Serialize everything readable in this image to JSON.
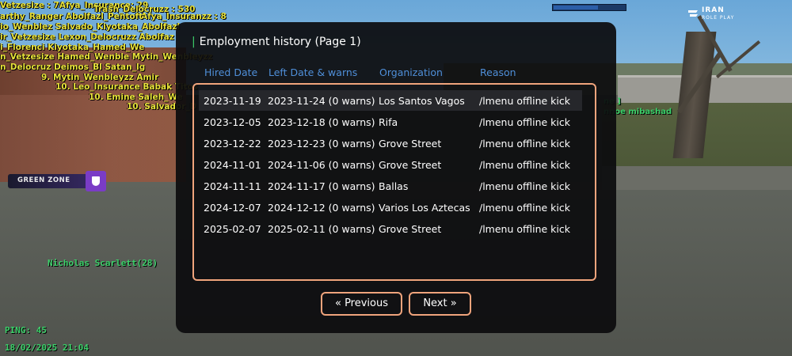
{
  "dialog": {
    "title": "Employment history (Page 1)",
    "columns": [
      "Hired Date",
      "Left Date & warns",
      "Organization",
      "Reason"
    ],
    "rows": [
      [
        "2023-11-19",
        "2023-11-24 (0 warns)",
        "Los Santos Vagos",
        "/lmenu offline kick"
      ],
      [
        "2023-12-05",
        "2023-12-18 (0 warns)",
        "Rifa",
        "/lmenu offline kick"
      ],
      [
        "2023-12-22",
        "2023-12-23 (0 warns)",
        "Grove Street",
        "/lmenu offline kick"
      ],
      [
        "2024-11-01",
        "2024-11-06 (0 warns)",
        "Grove Street",
        "/lmenu offline kick"
      ],
      [
        "2024-11-11",
        "2024-11-17 (0 warns)",
        "Ballas",
        "/lmenu offline kick"
      ],
      [
        "2024-12-07",
        "2024-12-12 (0 warns)",
        "Varios Los Aztecas",
        "/lmenu offline kick"
      ],
      [
        "2025-02-07",
        "2025-02-11 (0 warns)",
        "Grove Street",
        "/lmenu offline kick"
      ]
    ],
    "selected_row": 0,
    "prev_label": "« Previous",
    "next_label": "Next »"
  },
  "hud": {
    "green_zone": "GREEN ZONE",
    "player_label": "Nicholas Scarlett(28)",
    "ping": "PING: 45",
    "datetime": "18/02/2025 21:04",
    "logo_line1": "IRAN",
    "logo_line2": "ROLE PLAY",
    "hp_fraction": 0.62,
    "chat_line1": "ne ]",
    "chat_line2": "nnoe mibashad"
  },
  "killfeed": [
    "Vetzesize : 7Afya_Insurance: 29",
    "Trash_Delocruzz : 530",
    "Afya_Insuranzz : 8",
    "arthy_Ranger Abolfazl_Pentoft",
    "io_Wenblez Salvado_Kiyotaka_Abolfazl",
    "ir_Vetzesize Lexon_Delocruzz Abolfaz",
    "i_Florenci Kiyotaka_Hamed_We",
    "n_Vetzesize Hamed_Wenble Mytin_Wenbleyzz",
    "n_Delocruz Deimos_Bl Satan_Ig",
    "9. Mytin_Wenbleyzz Amir",
    "10. Leo_Insurance Babak Titos",
    "10. Emine Saleh_We",
    "10. Salvador_D"
  ],
  "colors": {
    "accent_border": "#f0a47c",
    "header_blue": "#4f8fd9",
    "hud_green": "#3cd06a",
    "killfeed_yellow": "#e8e23a"
  },
  "icons": [
    "shield-icon",
    "iran-roleplay-logo"
  ]
}
